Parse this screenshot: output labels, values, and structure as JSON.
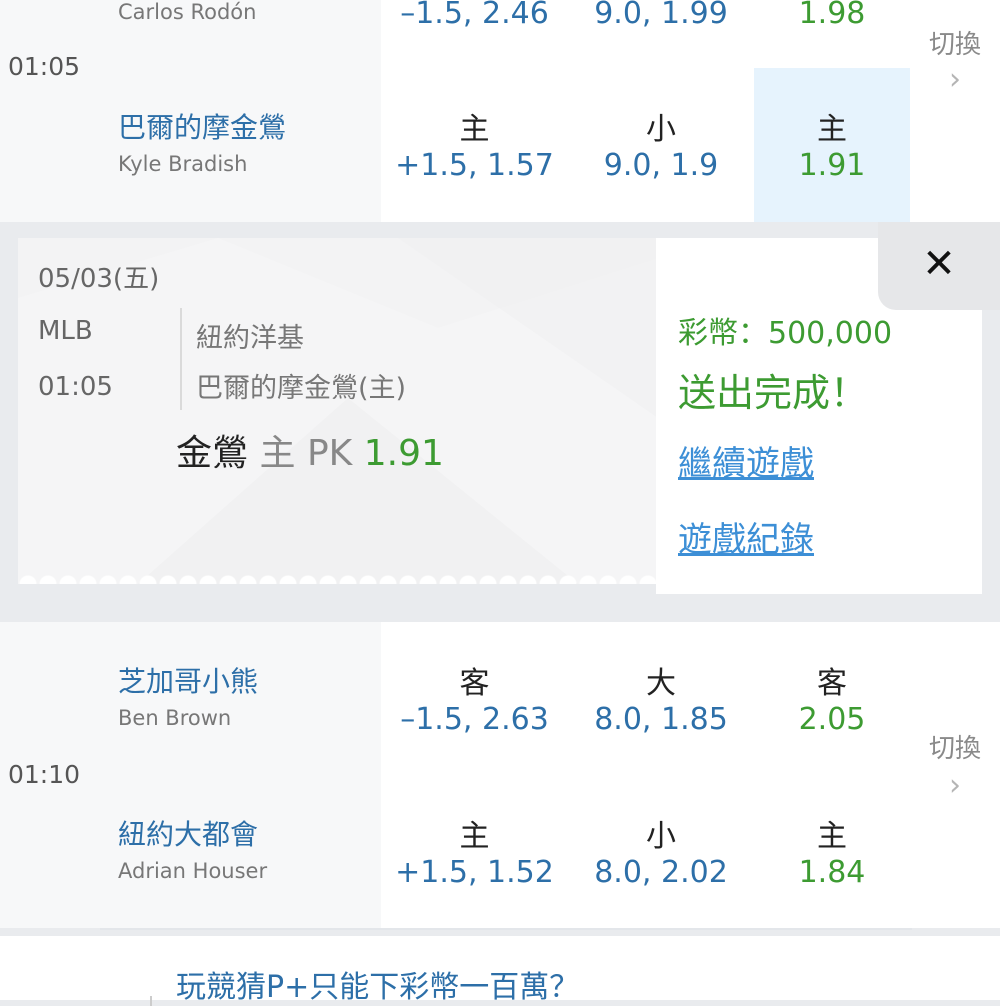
{
  "match_1": {
    "time": "01:05",
    "switch_label": "切換",
    "away": {
      "pitcher": "Carlos Rodón",
      "spread_value": "–1.5, 2.46",
      "total_value": "9.0, 1.99",
      "moneyline_value": "1.98"
    },
    "home": {
      "team": "巴爾的摩金鶯",
      "pitcher": "Kyle Bradish",
      "spread_label": "主",
      "spread_value": "+1.5, 1.57",
      "total_label": "小",
      "total_value": "9.0, 1.9",
      "moneyline_label": "主",
      "moneyline_value": "1.91"
    }
  },
  "bet_popup": {
    "date": "05/03(五)",
    "league": "MLB",
    "time": "01:05",
    "away_team": "紐約洋基",
    "home_team": "巴爾的摩金鶯(主)",
    "bet_team": "金鶯",
    "bet_side": "主",
    "bet_type": "PK",
    "bet_odds": "1.91",
    "coins": "彩幣：500,000",
    "status": "送出完成！",
    "continue_link": "繼續遊戲",
    "history_link": "遊戲紀錄",
    "close_symbol": "✕"
  },
  "match_2": {
    "time": "01:10",
    "switch_label": "切換",
    "away": {
      "team": "芝加哥小熊",
      "pitcher": "Ben Brown",
      "spread_label": "客",
      "spread_value": "–1.5, 2.63",
      "total_label": "大",
      "total_value": "8.0, 1.85",
      "moneyline_label": "客",
      "moneyline_value": "2.05"
    },
    "home": {
      "team": "紐約大都會",
      "pitcher": "Adrian Houser",
      "spread_label": "主",
      "spread_value": "+1.5, 1.52",
      "total_label": "小",
      "total_value": "8.0, 2.02",
      "moneyline_label": "主",
      "moneyline_value": "1.84"
    }
  },
  "promo": {
    "text": "玩競猜P+只能下彩幣一百萬？"
  },
  "icons": {
    "chevron": "›"
  },
  "colors": {
    "team_blue": "#2d6fa8",
    "odds_green": "#3d9b32",
    "link_blue": "#3d8fd6",
    "selected_bg": "#e6f3fd"
  }
}
